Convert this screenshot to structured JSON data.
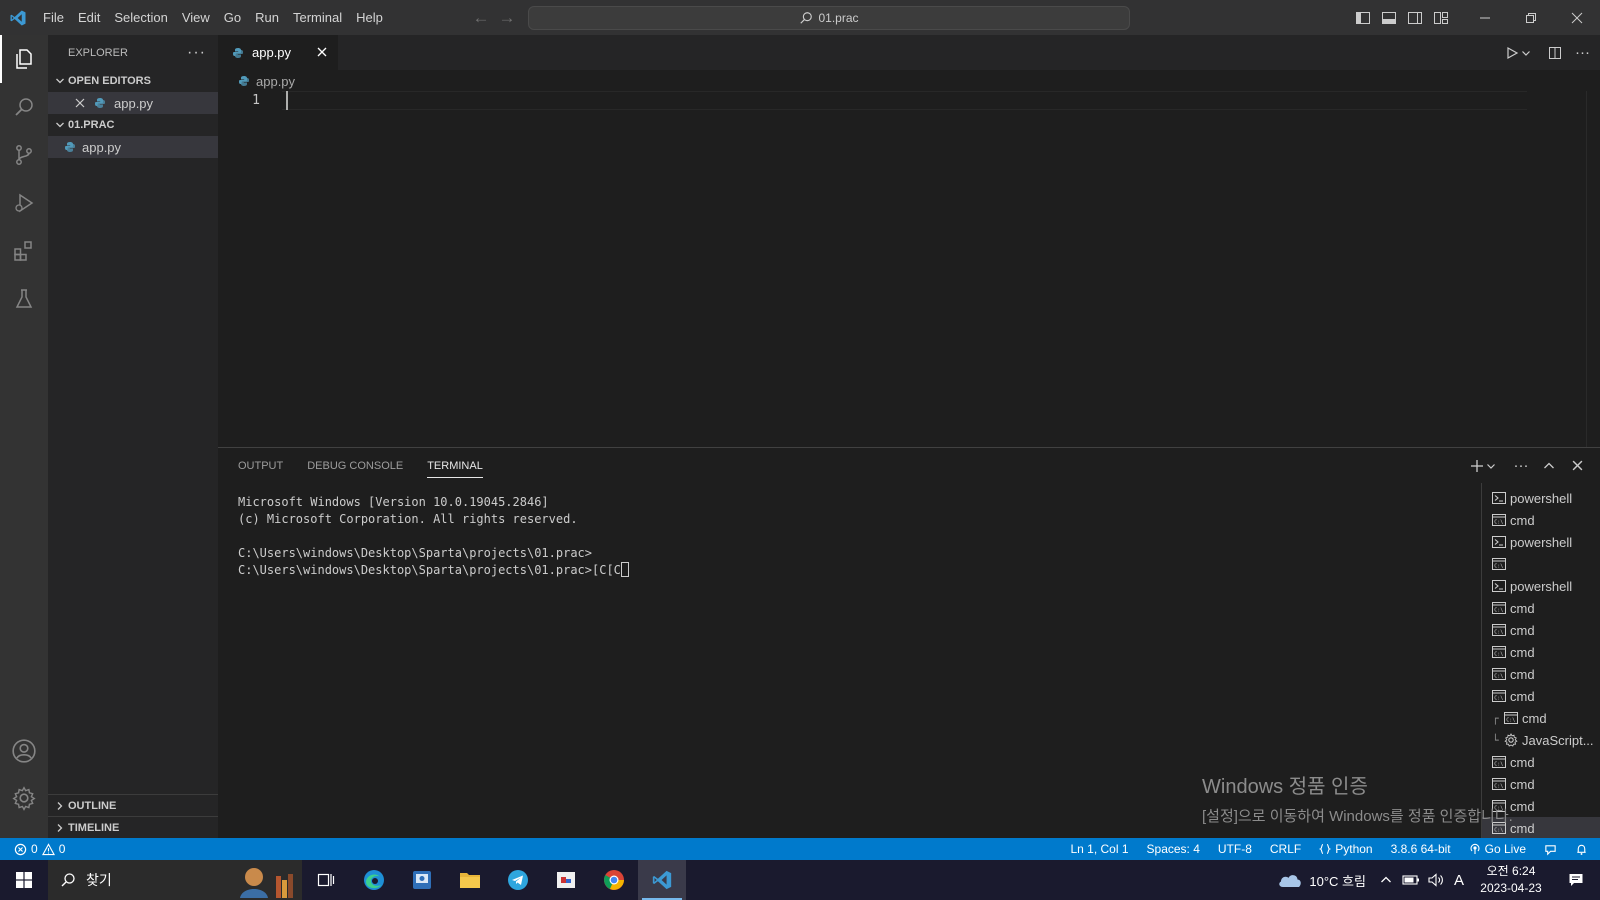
{
  "titlebar": {
    "menu": [
      "File",
      "Edit",
      "Selection",
      "View",
      "Go",
      "Run",
      "Terminal",
      "Help"
    ],
    "search_text": "01.prac",
    "icons": [
      "toggle-primary-sidebar-icon",
      "toggle-panel-icon",
      "toggle-secondary-sidebar-icon",
      "customize-layout-icon"
    ],
    "controls": [
      "minimize-icon",
      "restore-icon",
      "close-icon"
    ]
  },
  "sidebar": {
    "title": "EXPLORER",
    "open_editors_label": "OPEN EDITORS",
    "open_editors": [
      {
        "name": "app.py"
      }
    ],
    "folder_label": "01.PRAC",
    "files": [
      {
        "name": "app.py"
      }
    ],
    "outline_label": "OUTLINE",
    "timeline_label": "TIMELINE"
  },
  "tabs": [
    {
      "label": "app.py",
      "active": true
    }
  ],
  "breadcrumb": {
    "file": "app.py"
  },
  "editor": {
    "line_numbers": [
      "1"
    ],
    "content": ""
  },
  "panel": {
    "tabs": [
      "OUTPUT",
      "DEBUG CONSOLE",
      "TERMINAL"
    ],
    "active_tab": "TERMINAL",
    "terminal_lines": [
      "Microsoft Windows [Version 10.0.19045.2846]",
      "(c) Microsoft Corporation. All rights reserved.",
      "",
      "C:\\Users\\windows\\Desktop\\Sparta\\projects\\01.prac>",
      "C:\\Users\\windows\\Desktop\\Sparta\\projects\\01.prac>[C[C"
    ],
    "terminal_list": [
      {
        "label": "powershell",
        "icon": "powershell-icon"
      },
      {
        "label": "cmd",
        "icon": "cmd-icon"
      },
      {
        "label": "powershell",
        "icon": "powershell-icon"
      },
      {
        "label": "",
        "icon": "cmd-icon"
      },
      {
        "label": "powershell",
        "icon": "powershell-icon"
      },
      {
        "label": "cmd",
        "icon": "cmd-icon"
      },
      {
        "label": "cmd",
        "icon": "cmd-icon"
      },
      {
        "label": "cmd",
        "icon": "cmd-icon"
      },
      {
        "label": "cmd",
        "icon": "cmd-icon"
      },
      {
        "label": "cmd",
        "icon": "cmd-icon"
      },
      {
        "label": "cmd",
        "icon": "cmd-icon",
        "tree": "┌"
      },
      {
        "label": "JavaScript...",
        "icon": "debug-gear-icon",
        "tree": "└"
      },
      {
        "label": "cmd",
        "icon": "cmd-icon"
      },
      {
        "label": "cmd",
        "icon": "cmd-icon"
      },
      {
        "label": "cmd",
        "icon": "cmd-icon"
      },
      {
        "label": "cmd",
        "icon": "cmd-icon",
        "selected": true
      }
    ]
  },
  "watermark": {
    "line1": "Windows 정품 인증",
    "line2": "[설정]으로 이동하여 Windows를 정품 인증합니다."
  },
  "statusbar": {
    "errors": "0",
    "warnings": "0",
    "position": "Ln 1, Col 1",
    "spaces": "Spaces: 4",
    "encoding": "UTF-8",
    "eol": "CRLF",
    "language": "Python",
    "interpreter": "3.8.6 64-bit",
    "golive": "Go Live"
  },
  "taskbar": {
    "search_placeholder": "찾기",
    "weather": "10°C 흐림",
    "time": "오전 6:24",
    "date": "2023-04-23",
    "ime": "A"
  },
  "colors": {
    "accent": "#007acc",
    "tab_close": "#ffffff",
    "python_icon": "#519aba"
  }
}
